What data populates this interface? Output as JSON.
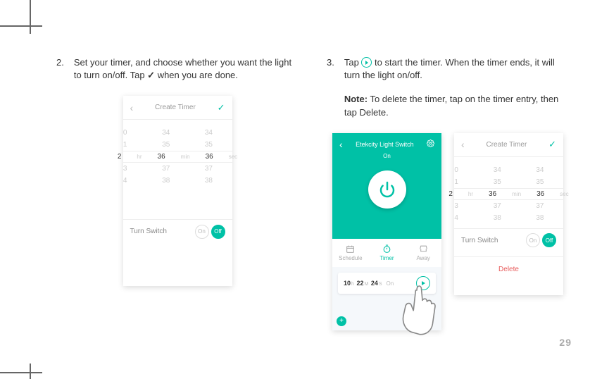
{
  "step2": {
    "num": "2.",
    "text_a": "Set your timer, and choose whether you want the light to turn on/off. Tap ",
    "check": "✓",
    "text_b": " when you are done."
  },
  "step3": {
    "num": "3.",
    "text_a": "Tap ",
    "text_b": " to start the timer. When the timer ends, it will turn the light on/off.",
    "note_label": "Note:",
    "note_text": " To delete the timer, tap on the timer entry, then tap Delete."
  },
  "create_timer": {
    "title": "Create Timer",
    "rows": [
      {
        "h": "0",
        "m": "34",
        "s": "34"
      },
      {
        "h": "1",
        "m": "35",
        "s": "35"
      },
      {
        "h": "2",
        "m": "36",
        "s": "36"
      },
      {
        "h": "3",
        "m": "37",
        "s": "37"
      },
      {
        "h": "4",
        "m": "38",
        "s": "38"
      }
    ],
    "units": {
      "hr": "hr",
      "min": "min",
      "sec": "sec"
    },
    "turn_switch": "Turn Switch",
    "on": "On",
    "off": "Off",
    "delete": "Delete"
  },
  "device": {
    "title": "Etekcity Light Switch",
    "status": "On",
    "tabs": {
      "schedule": "Schedule",
      "timer": "Timer",
      "away": "Away"
    },
    "countdown": {
      "h": "10",
      "m": "22",
      "s": "24",
      "hu": "h",
      "mu": "M",
      "su": "S",
      "state": "On"
    }
  },
  "page_number": "29"
}
